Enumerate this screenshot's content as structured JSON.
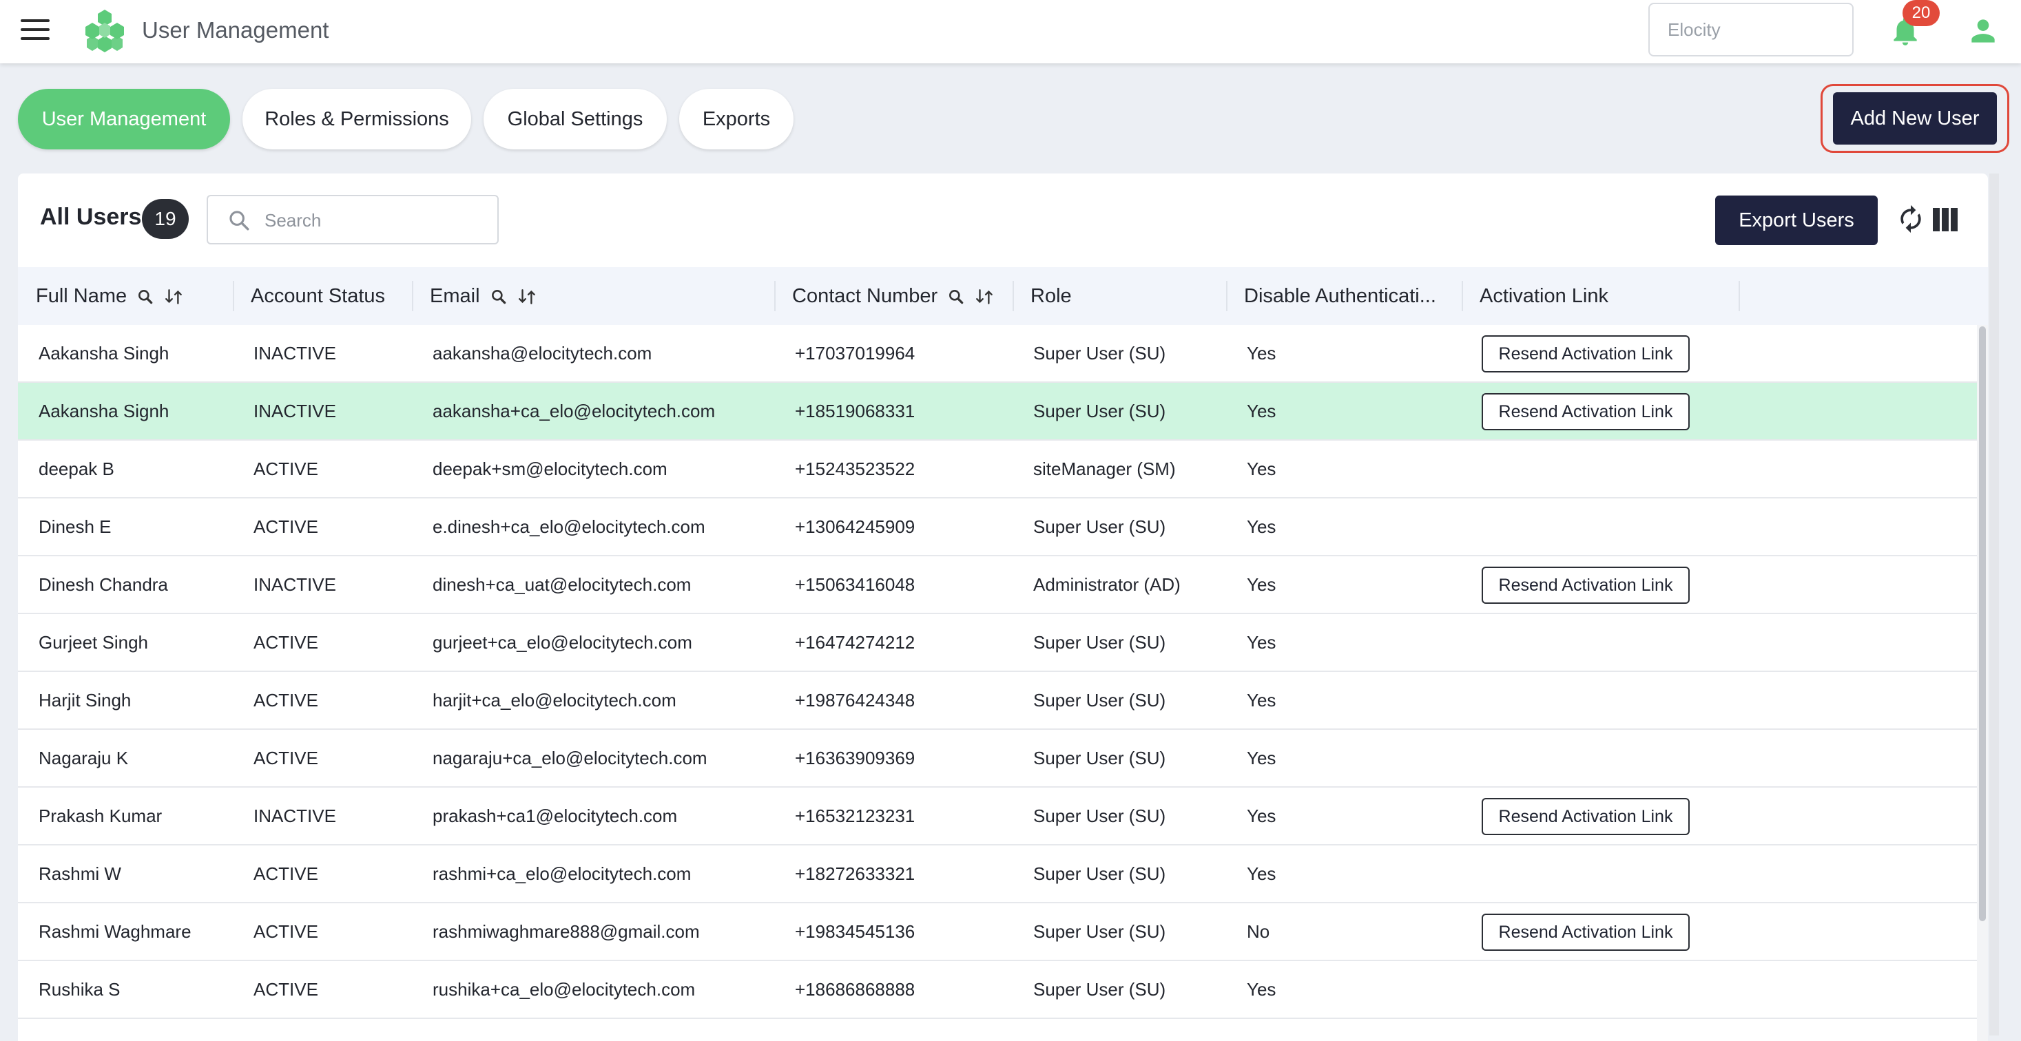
{
  "header": {
    "app_title": "User Management",
    "tenant_placeholder": "Elocity",
    "notification_count": "20"
  },
  "tabs": [
    {
      "label": "User Management",
      "active": true
    },
    {
      "label": "Roles & Permissions",
      "active": false
    },
    {
      "label": "Global Settings",
      "active": false
    },
    {
      "label": "Exports",
      "active": false
    }
  ],
  "actions": {
    "add_user_label": "Add New User",
    "export_label": "Export Users"
  },
  "users_panel": {
    "title": "All Users",
    "count": "19",
    "search_placeholder": "Search"
  },
  "columns": [
    "Full Name",
    "Account Status",
    "Email",
    "Contact Number",
    "Role",
    "Disable Authenticati...",
    "Activation Link"
  ],
  "resend_label": "Resend Activation Link",
  "rows": [
    {
      "name": "Aakansha Singh",
      "status": "INACTIVE",
      "email": "aakansha@elocitytech.com",
      "phone": "+17037019964",
      "role": "Super User (SU)",
      "disable_auth": "Yes",
      "resend": true,
      "highlighted": false
    },
    {
      "name": "Aakansha Signh",
      "status": "INACTIVE",
      "email": "aakansha+ca_elo@elocitytech.com",
      "phone": "+18519068331",
      "role": "Super User (SU)",
      "disable_auth": "Yes",
      "resend": true,
      "highlighted": true
    },
    {
      "name": "deepak B",
      "status": "ACTIVE",
      "email": "deepak+sm@elocitytech.com",
      "phone": "+15243523522",
      "role": "siteManager (SM)",
      "disable_auth": "Yes",
      "resend": false,
      "highlighted": false
    },
    {
      "name": "Dinesh E",
      "status": "ACTIVE",
      "email": "e.dinesh+ca_elo@elocitytech.com",
      "phone": "+13064245909",
      "role": "Super User (SU)",
      "disable_auth": "Yes",
      "resend": false,
      "highlighted": false
    },
    {
      "name": "Dinesh Chandra",
      "status": "INACTIVE",
      "email": "dinesh+ca_uat@elocitytech.com",
      "phone": "+15063416048",
      "role": "Administrator (AD)",
      "disable_auth": "Yes",
      "resend": true,
      "highlighted": false
    },
    {
      "name": "Gurjeet Singh",
      "status": "ACTIVE",
      "email": "gurjeet+ca_elo@elocitytech.com",
      "phone": "+16474274212",
      "role": "Super User (SU)",
      "disable_auth": "Yes",
      "resend": false,
      "highlighted": false
    },
    {
      "name": "Harjit Singh",
      "status": "ACTIVE",
      "email": "harjit+ca_elo@elocitytech.com",
      "phone": "+19876424348",
      "role": "Super User (SU)",
      "disable_auth": "Yes",
      "resend": false,
      "highlighted": false
    },
    {
      "name": "Nagaraju K",
      "status": "ACTIVE",
      "email": "nagaraju+ca_elo@elocitytech.com",
      "phone": "+16363909369",
      "role": "Super User (SU)",
      "disable_auth": "Yes",
      "resend": false,
      "highlighted": false
    },
    {
      "name": "Prakash Kumar",
      "status": "INACTIVE",
      "email": "prakash+ca1@elocitytech.com",
      "phone": "+16532123231",
      "role": "Super User (SU)",
      "disable_auth": "Yes",
      "resend": true,
      "highlighted": false
    },
    {
      "name": "Rashmi W",
      "status": "ACTIVE",
      "email": "rashmi+ca_elo@elocitytech.com",
      "phone": "+18272633321",
      "role": "Super User (SU)",
      "disable_auth": "Yes",
      "resend": false,
      "highlighted": false
    },
    {
      "name": "Rashmi Waghmare",
      "status": "ACTIVE",
      "email": "rashmiwaghmare888@gmail.com",
      "phone": "+19834545136",
      "role": "Super User (SU)",
      "disable_auth": "No",
      "resend": true,
      "highlighted": false
    },
    {
      "name": "Rushika S",
      "status": "ACTIVE",
      "email": "rushika+ca_elo@elocitytech.com",
      "phone": "+18686868888",
      "role": "Super User (SU)",
      "disable_auth": "Yes",
      "resend": false,
      "highlighted": false
    }
  ],
  "colors": {
    "accent_green": "#5dcb7a",
    "primary_navy": "#1f2340",
    "highlight_row": "#cff5e0",
    "alert_red": "#e24b3b"
  }
}
